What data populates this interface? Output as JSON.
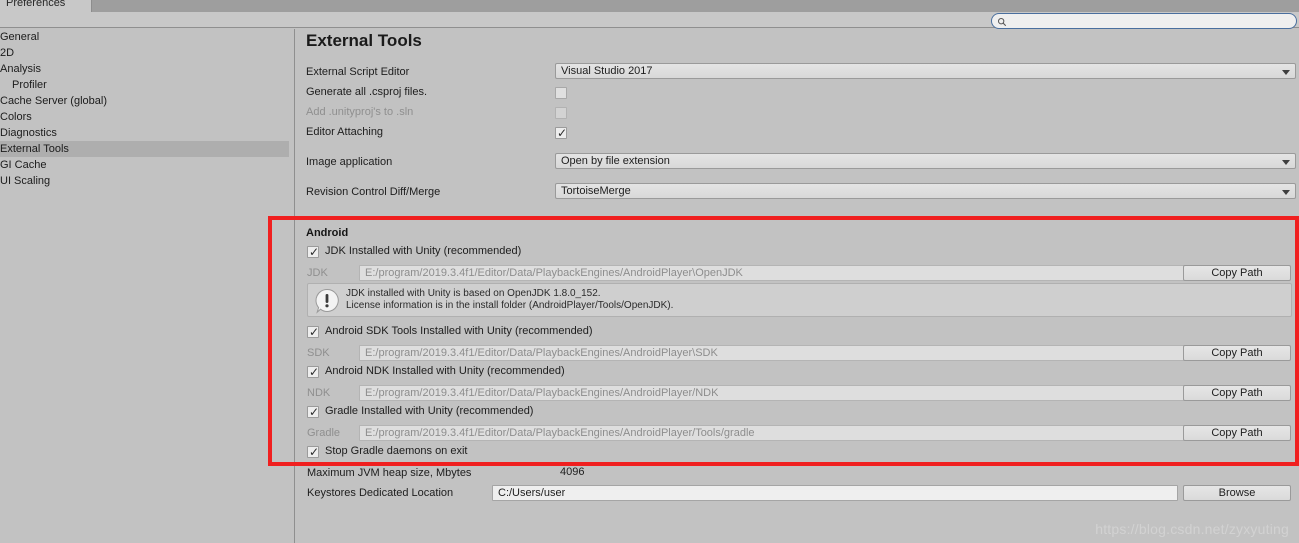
{
  "window": {
    "tab_label": "Preferences"
  },
  "search": {
    "value": "",
    "placeholder": "",
    "icon": "search-icon"
  },
  "sidebar": {
    "items": [
      {
        "label": "General",
        "indent": false,
        "selected": false
      },
      {
        "label": "2D",
        "indent": false,
        "selected": false
      },
      {
        "label": "Analysis",
        "indent": false,
        "selected": false
      },
      {
        "label": "Profiler",
        "indent": true,
        "selected": false
      },
      {
        "label": "Cache Server (global)",
        "indent": false,
        "selected": false
      },
      {
        "label": "Colors",
        "indent": false,
        "selected": false
      },
      {
        "label": "Diagnostics",
        "indent": false,
        "selected": false
      },
      {
        "label": "External Tools",
        "indent": false,
        "selected": true
      },
      {
        "label": "GI Cache",
        "indent": false,
        "selected": false
      },
      {
        "label": "UI Scaling",
        "indent": false,
        "selected": false
      }
    ]
  },
  "main": {
    "title": "External Tools",
    "rows": {
      "external_script_editor": {
        "label": "External Script Editor",
        "value": "Visual Studio 2017"
      },
      "generate_csproj": {
        "label": "Generate all .csproj files.",
        "checked": false,
        "disabled": false
      },
      "add_unityproj": {
        "label": "Add .unityproj's to .sln",
        "checked": false,
        "disabled": true
      },
      "editor_attaching": {
        "label": "Editor Attaching",
        "checked": true,
        "disabled": false
      },
      "image_application": {
        "label": "Image application",
        "value": "Open by file extension"
      },
      "revision_control": {
        "label": "Revision Control Diff/Merge",
        "value": "TortoiseMerge"
      }
    },
    "android": {
      "heading": "Android",
      "jdk_checkbox": {
        "label": "JDK Installed with Unity (recommended)",
        "checked": true
      },
      "jdk_field": {
        "label": "JDK",
        "value": "E:/program/2019.3.4f1/Editor/Data/PlaybackEngines/AndroidPlayer\\OpenJDK",
        "button": "Copy Path"
      },
      "jdk_help": {
        "text": "JDK installed with Unity is based on OpenJDK 1.8.0_152.\nLicense information is in the install folder (AndroidPlayer/Tools/OpenJDK).",
        "icon": "warning-icon"
      },
      "sdk_checkbox": {
        "label": "Android SDK Tools Installed with Unity (recommended)",
        "checked": true
      },
      "sdk_field": {
        "label": "SDK",
        "value": "E:/program/2019.3.4f1/Editor/Data/PlaybackEngines/AndroidPlayer\\SDK",
        "button": "Copy Path"
      },
      "ndk_checkbox": {
        "label": "Android NDK Installed with Unity (recommended)",
        "checked": true
      },
      "ndk_field": {
        "label": "NDK",
        "value": "E:/program/2019.3.4f1/Editor/Data/PlaybackEngines/AndroidPlayer/NDK",
        "button": "Copy Path"
      },
      "gradle_checkbox": {
        "label": "Gradle Installed with Unity (recommended)",
        "checked": true
      },
      "gradle_field": {
        "label": "Gradle",
        "value": "E:/program/2019.3.4f1/Editor/Data/PlaybackEngines/AndroidPlayer/Tools/gradle",
        "button": "Copy Path"
      },
      "stop_gradle_checkbox": {
        "label": "Stop Gradle daemons on exit",
        "checked": true
      },
      "jvm_heap": {
        "label": "Maximum JVM heap size, Mbytes",
        "value": "4096"
      },
      "keystores": {
        "label": "Keystores Dedicated Location",
        "value": "C:/Users/user",
        "button": "Browse"
      }
    }
  },
  "annotation": {
    "highlight_color": "#f01f1f"
  },
  "watermark": {
    "text": "https://blog.csdn.net/zyxyuting"
  }
}
